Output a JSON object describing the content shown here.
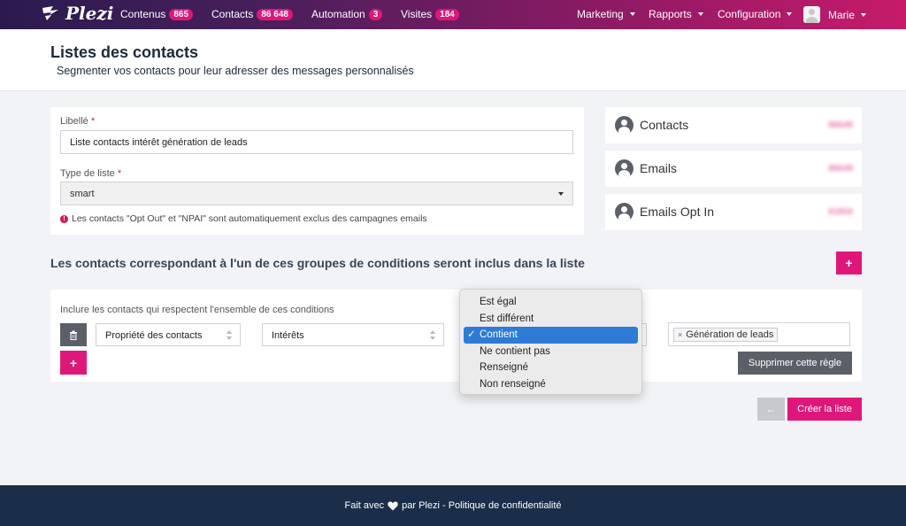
{
  "nav": {
    "logo": "Plezi",
    "items": [
      {
        "label": "Contenus",
        "badge": "865"
      },
      {
        "label": "Contacts",
        "badge": "86 648"
      },
      {
        "label": "Automation",
        "badge": "3"
      },
      {
        "label": "Visites",
        "badge": "184"
      }
    ],
    "right_menus": [
      "Marketing",
      "Rapports",
      "Configuration"
    ],
    "user": "Marie"
  },
  "header": {
    "title": "Listes des contacts",
    "subtitle": "Segmenter vos contacts pour leur adresser des messages personnalisés"
  },
  "form": {
    "libelle_label": "Libellé",
    "required_mark": "*",
    "libelle_value": "Liste contacts intérêt génération de leads",
    "type_label": "Type de liste",
    "type_value": "smart",
    "notice": "Les contacts \"Opt Out\" et \"NPAI\" sont automatiquement exclus des campagnes emails"
  },
  "stats": [
    {
      "label": "Contacts",
      "value": "86649"
    },
    {
      "label": "Emails",
      "value": "86649"
    },
    {
      "label": "Emails Opt In",
      "value": "61804"
    }
  ],
  "section": {
    "title": "Les contacts correspondant à l'un de ces groupes de conditions seront inclus dans la liste",
    "add_group_label": "+"
  },
  "conditions": {
    "caption": "Inclure les contacts qui respectent l'ensemble de ces conditions",
    "property": "Propriété des contacts",
    "field": "Intérêts",
    "tag": "Génération de leads",
    "tag_remove": "×",
    "delete_rule": "Supprimer cette règle",
    "add_rule_label": "+"
  },
  "operator_dropdown": {
    "options": [
      "Est égal",
      "Est différent",
      "Contient",
      "Ne contient pas",
      "Renseigné",
      "Non renseigné"
    ],
    "selected": "Contient",
    "check": "✓"
  },
  "actions": {
    "back": "←",
    "create": "Créer la liste"
  },
  "footer": {
    "prefix": "Fait avec",
    "suffix": "par Plezi - Politique de confidentialité"
  },
  "colors": {
    "accent": "#e0177a",
    "dark_button": "#5b6068",
    "footer_bg": "#1a2d49",
    "selected_option": "#2e7bd6"
  }
}
